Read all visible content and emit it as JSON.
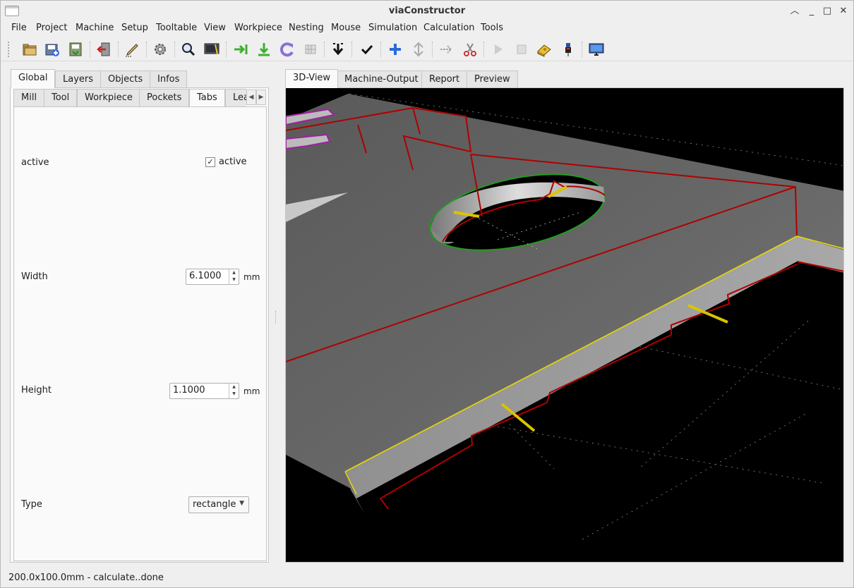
{
  "window": {
    "title": "viaConstructor"
  },
  "menu": [
    "File",
    "Project",
    "Machine",
    "Setup",
    "Tooltable",
    "View",
    "Workpiece",
    "Nesting",
    "Mouse",
    "Simulation",
    "Calculation",
    "Tools"
  ],
  "toolbar": {
    "icons": [
      "open-folder-icon",
      "save-icon",
      "save-as-icon",
      "exit-icon",
      "draw-icon",
      "settings-icon",
      "zoom-icon",
      "screenshot-icon",
      "move-forward-icon",
      "download-icon",
      "rotate-icon",
      "grid-icon",
      "arrow-down-icon",
      "check-icon",
      "add-icon",
      "move-icon",
      "arrow-right-icon",
      "cut-icon",
      "play-icon",
      "stop-icon",
      "cheese-icon",
      "probe-icon",
      "monitor-icon"
    ]
  },
  "left_tabs": [
    "Global",
    "Layers",
    "Objects",
    "Infos"
  ],
  "sub_tabs": [
    "Mill",
    "Tool",
    "Workpiece",
    "Pockets",
    "Tabs",
    "Lea"
  ],
  "right_tabs": [
    "3D-View",
    "Machine-Output",
    "Report",
    "Preview"
  ],
  "form": {
    "active_label": "active",
    "active_checkbox_label": "active",
    "active_checked": true,
    "width_label": "Width",
    "width_value": "6.1000",
    "width_unit": "mm",
    "height_label": "Height",
    "height_value": "1.1000",
    "height_unit": "mm",
    "type_label": "Type",
    "type_value": "rectangle"
  },
  "status": "200.0x100.0mm - calculate..done",
  "colors": {
    "toolpath": "#b00000",
    "tab_marker": "#d9c400",
    "edge_highlight": "#e6d800",
    "hole_outline": "#1f9e1f",
    "purple_outline": "#a020a0"
  }
}
